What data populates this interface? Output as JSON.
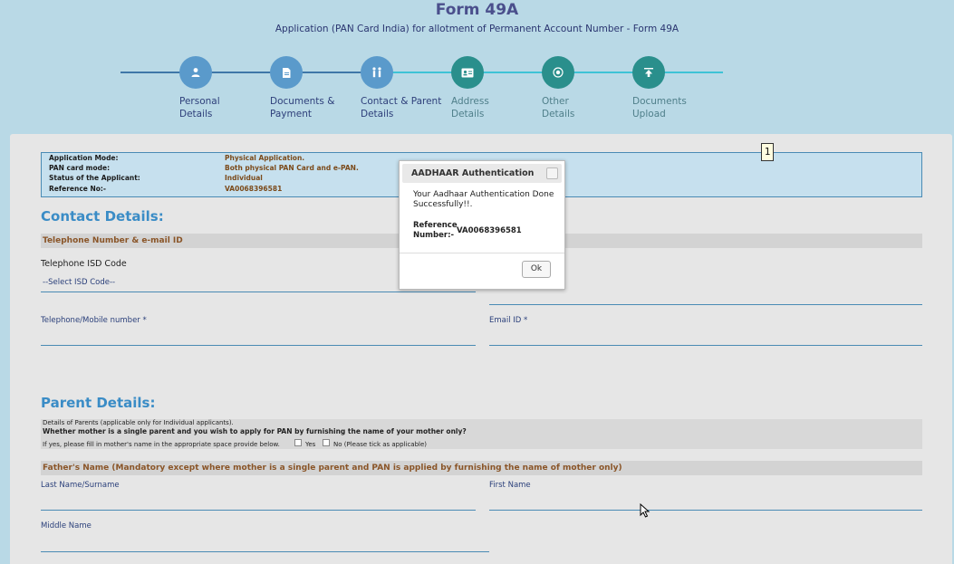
{
  "header": {
    "title": "Form 49A",
    "subtitle": "Application (PAN Card India) for allotment of Permanent Account Number - Form 49A"
  },
  "steps": [
    {
      "line1": "Personal",
      "line2": "Details",
      "icon": "person-icon",
      "status": "done"
    },
    {
      "line1": "Documents &",
      "line2": "Payment",
      "icon": "document-icon",
      "status": "done"
    },
    {
      "line1": "Contact & Parent",
      "line2": "Details",
      "icon": "family-icon",
      "status": "done"
    },
    {
      "line1": "Address",
      "line2": "Details",
      "icon": "id-card-icon",
      "status": "todo"
    },
    {
      "line1": "Other",
      "line2": "Details",
      "icon": "target-icon",
      "status": "todo"
    },
    {
      "line1": "Documents",
      "line2": "Upload",
      "icon": "upload-icon",
      "status": "todo"
    }
  ],
  "badge": "1",
  "info": {
    "mode_label": "Application Mode:",
    "mode_value": "Physical Application.",
    "card_label": "PAN card mode:",
    "card_value": "Both physical PAN Card and e-PAN.",
    "status_label": "Status of the Applicant:",
    "status_value": "Individual",
    "ref_label": "Reference No:-",
    "ref_value": "VA0068396581"
  },
  "contact": {
    "heading": "Contact Details:",
    "subheader": "Telephone Number & e-mail ID",
    "isd_label": "Telephone ISD Code",
    "isd_select": "--Select ISD Code--",
    "phone_label": "Telephone/Mobile number *",
    "email_label": "Email ID *"
  },
  "parent": {
    "heading": "Parent Details:",
    "note1": "Details of Parents (applicable only for Individual applicants).",
    "note2": "Whether mother is a single parent and you wish to apply for PAN by furnishing the name of your mother only?",
    "note3": "If yes, please fill in mother's name in the appropriate space provide below.",
    "yes": "Yes",
    "no": "No (Please tick as applicable)",
    "father_header": "Father's Name (Mandatory except where mother is a single parent and PAN is applied by furnishing the name of mother only)",
    "last_name": "Last Name/Surname",
    "first_name": "First Name",
    "middle_name": "Middle Name"
  },
  "modal": {
    "title": "AADHAAR Authentication",
    "message": "Your Aadhaar Authentication Done Successfully!!.",
    "ref_label": "Reference Number:-",
    "ref_value": "VA0068396581",
    "ok": "Ok"
  }
}
